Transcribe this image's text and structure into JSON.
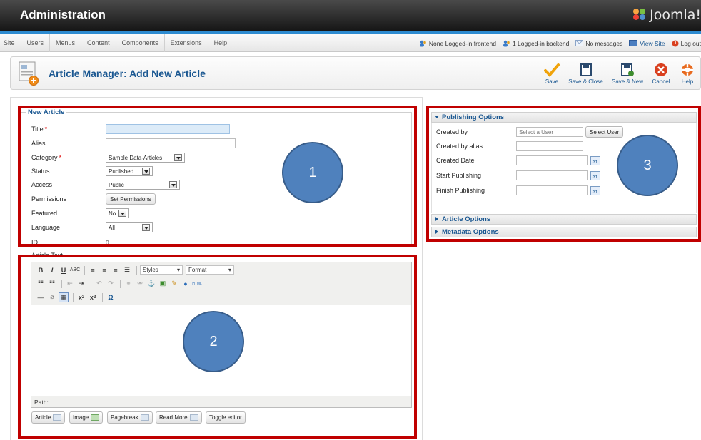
{
  "header": {
    "title": "Administration",
    "logo_text": "Joomla!"
  },
  "menu": [
    "Site",
    "Users",
    "Menus",
    "Content",
    "Components",
    "Extensions",
    "Help"
  ],
  "status": {
    "frontend": "None Logged-in frontend",
    "backend": "1 Logged-in backend",
    "messages": "No messages",
    "view_site": "View Site",
    "logout": "Log out"
  },
  "toolbar": {
    "page_title": "Article Manager: Add New Article",
    "save": "Save",
    "save_close": "Save & Close",
    "save_new": "Save & New",
    "cancel": "Cancel",
    "help": "Help"
  },
  "form": {
    "legend": "New Article",
    "title_label": "Title",
    "title_value": "",
    "alias_label": "Alias",
    "alias_value": "",
    "category_label": "Category",
    "category_value": "Sample Data-Articles",
    "status_label": "Status",
    "status_value": "Published",
    "access_label": "Access",
    "access_value": "Public",
    "permissions_label": "Permissions",
    "permissions_button": "Set Permissions",
    "featured_label": "Featured",
    "featured_value": "No",
    "language_label": "Language",
    "language_value": "All",
    "id_label": "ID",
    "id_value": "0",
    "article_text_label": "Article Text",
    "required_mark": "*"
  },
  "editor": {
    "styles": "Styles",
    "format": "Format",
    "path_label": "Path:",
    "buttons": [
      "Article",
      "Image",
      "Pagebreak",
      "Read More",
      "Toggle editor"
    ]
  },
  "publishing": {
    "header": "Publishing Options",
    "created_by_label": "Created by",
    "created_by_placeholder": "Select a User",
    "select_user_button": "Select User",
    "created_by_alias_label": "Created by alias",
    "created_date_label": "Created Date",
    "start_publishing_label": "Start Publishing",
    "finish_publishing_label": "Finish Publishing",
    "calendar_glyph": "31"
  },
  "accordion": {
    "article_options": "Article Options",
    "metadata_options": "Metadata Options"
  },
  "annotations": [
    "1",
    "2",
    "3"
  ],
  "colors": {
    "accent": "#1a5791",
    "annotation_border": "#c00000",
    "annotation_circle": "#4f81bd",
    "header_blue_line": "#2d8bd0"
  }
}
